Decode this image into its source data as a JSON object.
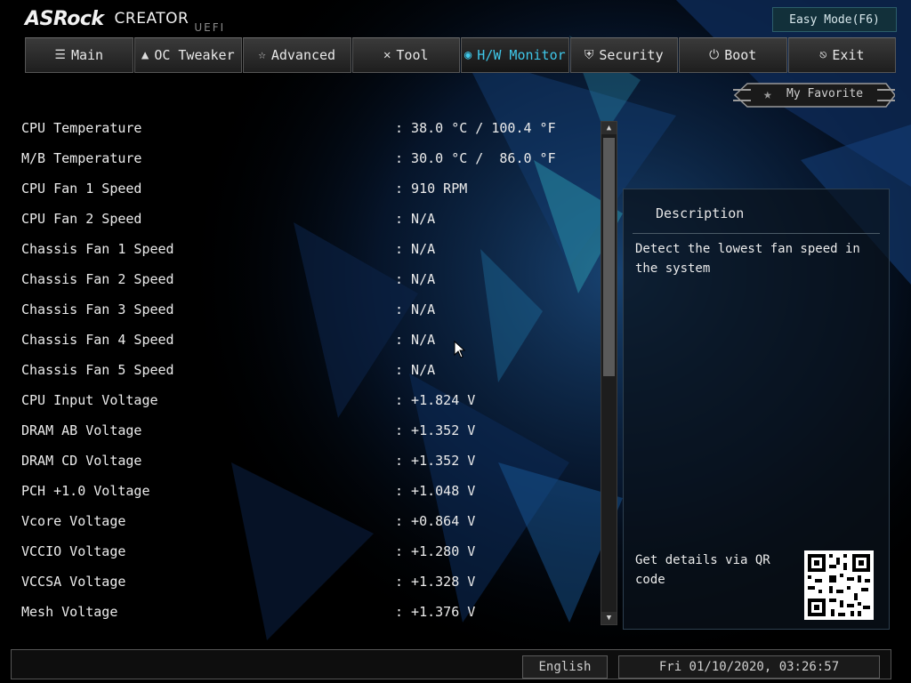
{
  "brand": {
    "name": "ASRock",
    "product": "CREATOR",
    "sub": "UEFI"
  },
  "header": {
    "easy_mode": "Easy Mode(F6)"
  },
  "tabs": [
    {
      "label": "Main",
      "icon": "list-icon",
      "active": false
    },
    {
      "label": "OC Tweaker",
      "icon": "rocket-icon",
      "active": false
    },
    {
      "label": "Advanced",
      "icon": "star-icon",
      "active": false
    },
    {
      "label": "Tool",
      "icon": "wrench-icon",
      "active": false
    },
    {
      "label": "H/W Monitor",
      "icon": "monitor-icon",
      "active": true
    },
    {
      "label": "Security",
      "icon": "shield-icon",
      "active": false
    },
    {
      "label": "Boot",
      "icon": "power-icon",
      "active": false
    },
    {
      "label": "Exit",
      "icon": "exit-icon",
      "active": false
    }
  ],
  "favorite": {
    "label": "My Favorite"
  },
  "monitor": [
    {
      "label": "CPU Temperature",
      "value": ": 38.0 °C / 100.4 °F"
    },
    {
      "label": "M/B Temperature",
      "value": ": 30.0 °C /  86.0 °F"
    },
    {
      "label": "CPU Fan 1 Speed",
      "value": ": 910 RPM"
    },
    {
      "label": "CPU Fan 2 Speed",
      "value": ": N/A"
    },
    {
      "label": "Chassis Fan 1 Speed",
      "value": ": N/A"
    },
    {
      "label": "Chassis Fan 2 Speed",
      "value": ": N/A"
    },
    {
      "label": "Chassis Fan 3 Speed",
      "value": ": N/A"
    },
    {
      "label": "Chassis Fan 4 Speed",
      "value": ": N/A"
    },
    {
      "label": "Chassis Fan 5 Speed",
      "value": ": N/A"
    },
    {
      "label": "CPU Input Voltage",
      "value": ": +1.824 V"
    },
    {
      "label": "DRAM AB Voltage",
      "value": ": +1.352 V"
    },
    {
      "label": "DRAM CD Voltage",
      "value": ": +1.352 V"
    },
    {
      "label": "PCH +1.0 Voltage",
      "value": ": +1.048 V"
    },
    {
      "label": "Vcore Voltage",
      "value": ": +0.864 V"
    },
    {
      "label": "VCCIO Voltage",
      "value": ": +1.280 V"
    },
    {
      "label": "VCCSA Voltage",
      "value": ": +1.328 V"
    },
    {
      "label": "Mesh Voltage",
      "value": ": +1.376 V"
    }
  ],
  "description": {
    "title": "Description",
    "text": "Detect the lowest fan speed in the system",
    "qr_text": "Get details via QR code"
  },
  "footer": {
    "language": "English",
    "datetime": "Fri 01/10/2020, 03:26:57"
  },
  "colors": {
    "accent": "#3fc8ea",
    "background": "#000000"
  }
}
